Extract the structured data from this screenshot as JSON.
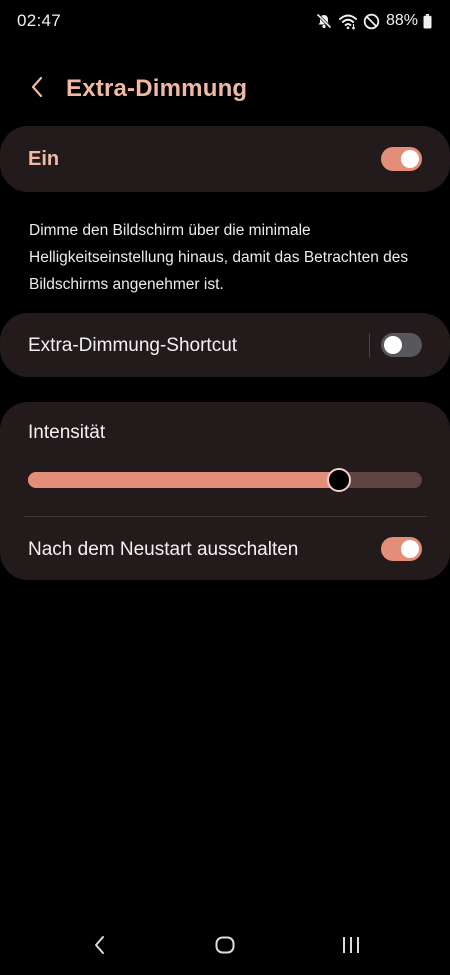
{
  "status_bar": {
    "time": "02:47",
    "battery": "88%",
    "icons": [
      "mute-icon",
      "wifi-icon",
      "do-not-disturb-icon",
      "battery-icon"
    ]
  },
  "header": {
    "back_icon": "chevron-left-icon",
    "title": "Extra-Dimmung"
  },
  "main_toggle": {
    "label": "Ein",
    "on": true
  },
  "description": "Dimme den Bildschirm über die minimale Helligkeitseinstellung hinaus, damit das Betrachten des Bildschirms angenehmer ist.",
  "shortcut": {
    "label": "Extra-Dimmung-Shortcut",
    "on": false
  },
  "intensity": {
    "label": "Intensität",
    "value_fraction": 0.79
  },
  "restart": {
    "label": "Nach dem Neustart ausschalten",
    "on": true
  },
  "colors": {
    "accent": "#e38e79",
    "title": "#efb9a4",
    "card": "#231b1b",
    "background": "#000000"
  },
  "nav_bar": {
    "icons": [
      "back-icon",
      "home-icon",
      "recents-icon"
    ]
  }
}
